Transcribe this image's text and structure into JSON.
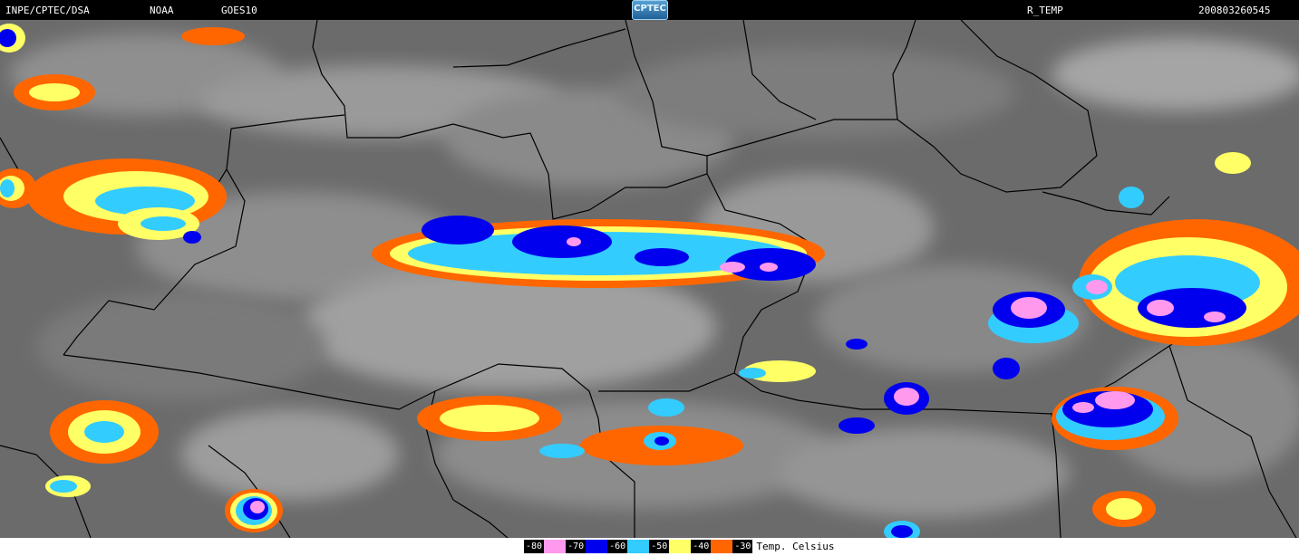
{
  "header": {
    "source": "INPE/CPTEC/DSA",
    "agency": "NOAA",
    "satellite": "GOES10",
    "logo_text": "CPTEC",
    "product": "R_TEMP",
    "timestamp": "200803260545"
  },
  "legend": {
    "title": "Temp. Celsius",
    "items": [
      {
        "label": "-80",
        "color": "#ff99ee"
      },
      {
        "label": "-70",
        "color": "#0000ee"
      },
      {
        "label": "-60",
        "color": "#33ccff"
      },
      {
        "label": "-50",
        "color": "#ffff66"
      },
      {
        "label": "-40",
        "color": "#ff6600"
      },
      {
        "label": "-30",
        "color": "#000000"
      }
    ]
  },
  "colors": {
    "background": "#6e6e6e",
    "cloud": "#a8a8a8",
    "border_line": "#000000"
  }
}
